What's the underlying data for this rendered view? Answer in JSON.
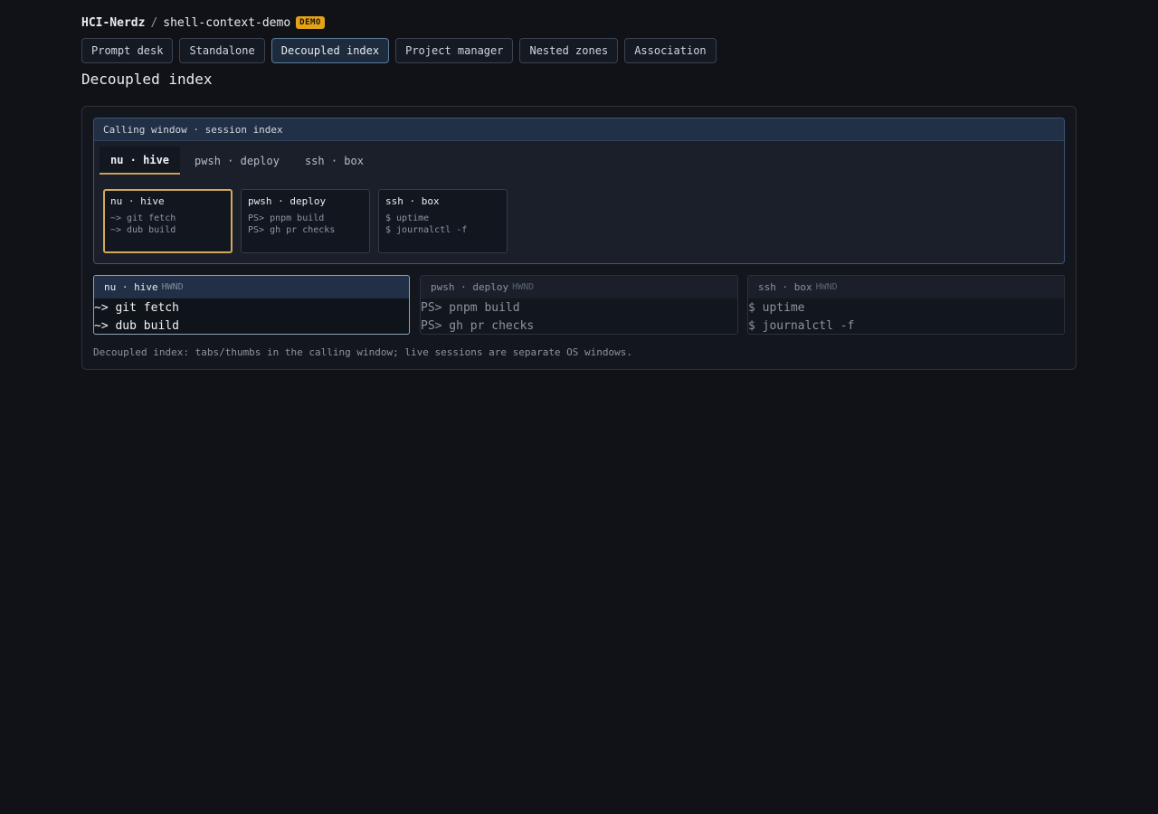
{
  "breadcrumb": {
    "org": "HCI-Nerdz",
    "separator": "/",
    "repo": "shell-context-demo",
    "badge": "DEMO"
  },
  "nav_tabs": [
    {
      "label": "Prompt desk",
      "active": false
    },
    {
      "label": "Standalone",
      "active": false
    },
    {
      "label": "Decoupled index",
      "active": true
    },
    {
      "label": "Project manager",
      "active": false
    },
    {
      "label": "Nested zones",
      "active": false
    },
    {
      "label": "Association",
      "active": false
    }
  ],
  "page_title": "Decoupled index",
  "calling_window": {
    "header": "Calling window · session index",
    "tabs": [
      {
        "label": "nu · hive",
        "active": true
      },
      {
        "label": "pwsh · deploy",
        "active": false
      },
      {
        "label": "ssh · box",
        "active": false
      }
    ],
    "thumbs": [
      {
        "title": "nu · hive",
        "lines": [
          "~> git fetch",
          "~> dub build"
        ],
        "active": true
      },
      {
        "title": "pwsh · deploy",
        "lines": [
          "PS> pnpm build",
          "PS> gh pr checks"
        ],
        "active": false
      },
      {
        "title": "ssh · box",
        "lines": [
          "$ uptime",
          "$ journalctl -f"
        ],
        "active": false
      }
    ]
  },
  "hwnd_windows": [
    {
      "title": "nu · hive",
      "tag": "HWND",
      "lines": [
        "~> git fetch",
        "~> dub build"
      ],
      "active": true
    },
    {
      "title": "pwsh · deploy",
      "tag": "HWND",
      "lines": [
        "PS> pnpm build",
        "PS> gh pr checks"
      ],
      "active": false
    },
    {
      "title": "ssh · box",
      "tag": "HWND",
      "lines": [
        "$ uptime",
        "$ journalctl -f"
      ],
      "active": false
    }
  ],
  "footnote": "Decoupled index: tabs/thumbs in the calling window; live sessions are separate OS windows.",
  "colors": {
    "background": "#111218",
    "accent_badge": "#e3a21a",
    "active_thumb_border": "#d4a85b",
    "active_tab_bg": "#1d2b3c"
  }
}
